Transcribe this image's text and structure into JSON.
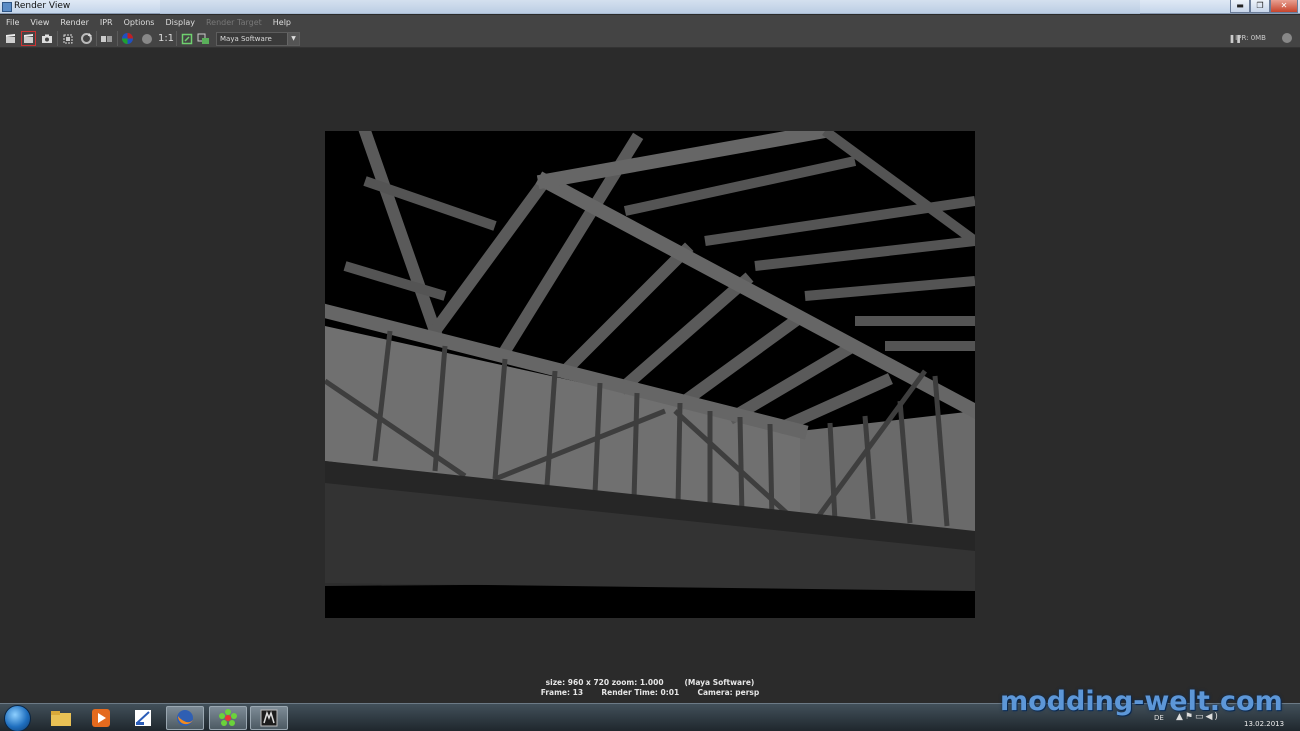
{
  "window": {
    "title": "Render View",
    "buttons": {
      "minimize": "▬",
      "maximize": "❐",
      "close": "✕"
    }
  },
  "menu": {
    "items": [
      {
        "label": "File",
        "enabled": true
      },
      {
        "label": "View",
        "enabled": true
      },
      {
        "label": "Render",
        "enabled": true
      },
      {
        "label": "IPR",
        "enabled": true
      },
      {
        "label": "Options",
        "enabled": true
      },
      {
        "label": "Display",
        "enabled": true
      },
      {
        "label": "Render Target",
        "enabled": false
      },
      {
        "label": "Help",
        "enabled": true
      }
    ]
  },
  "toolbar": {
    "one_to_one": "1:1",
    "renderer": "Maya Software",
    "ipr_status": "IPR: 0MB",
    "icons": {
      "redo_render": "clapper-icon",
      "ipr_render": "ipr-clapper-icon",
      "snapshot": "camera-icon",
      "region": "region-render-icon",
      "refresh": "refresh-icon",
      "keep_image": "keep-image-icon",
      "rgb_channels": "rgb-channel-icon",
      "alpha": "alpha-channel-icon",
      "zoom": "real-size-icon",
      "display_settings": "display-icon",
      "editor": "render-settings-icon"
    }
  },
  "render_info": {
    "line1": "size: 960 x 720 zoom: 1.000        (Maya Software)",
    "line2": "Frame: 13       Render Time: 0:01       Camera: persp"
  },
  "taskbar": {
    "apps": [
      "explorer-icon",
      "media-player-icon",
      "paint-icon",
      "firefox-icon",
      "icq-icon",
      "maya-icon"
    ],
    "language": "DE",
    "date": "13.02.2013"
  },
  "watermark": "modding-welt.com"
}
